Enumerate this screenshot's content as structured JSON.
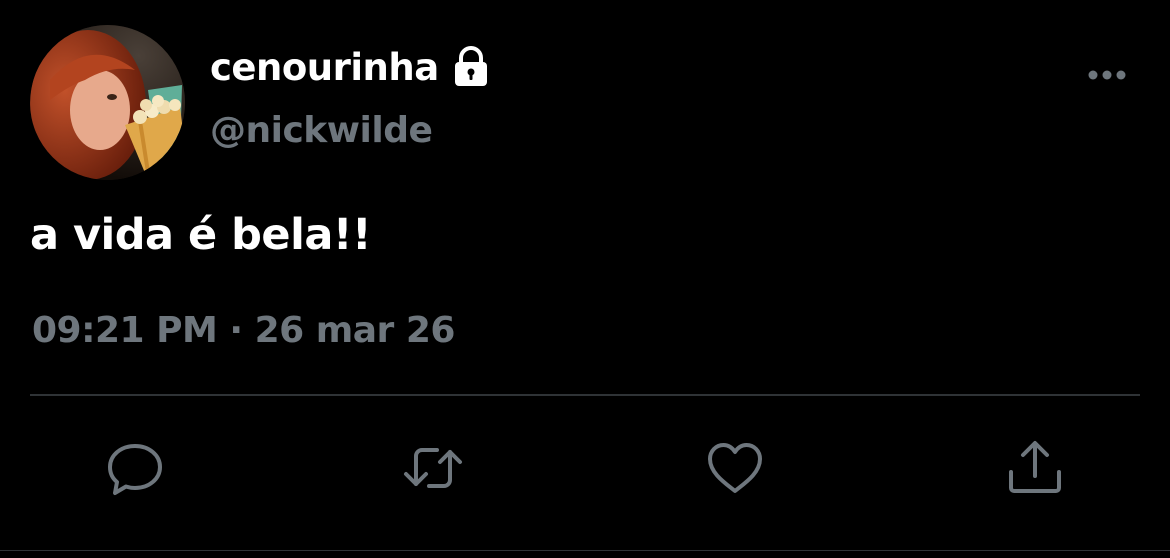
{
  "user": {
    "display_name": "cenourinha",
    "handle": "@nickwilde",
    "protected_icon": "lock-icon",
    "avatar_description_icon": "avatar-photo"
  },
  "tweet": {
    "text": "a vida é bela!!",
    "time": "09:21 PM",
    "separator": " · ",
    "date": "26 mar 26"
  },
  "actions": [
    {
      "name": "reply",
      "icon": "reply-icon"
    },
    {
      "name": "retweet",
      "icon": "retweet-icon"
    },
    {
      "name": "like",
      "icon": "heart-icon"
    },
    {
      "name": "share",
      "icon": "share-icon"
    }
  ],
  "more_icon": "more-icon",
  "colors": {
    "background": "#000000",
    "primary_text": "#ffffff",
    "secondary_text": "#6e767d",
    "divider": "#2f3336"
  }
}
